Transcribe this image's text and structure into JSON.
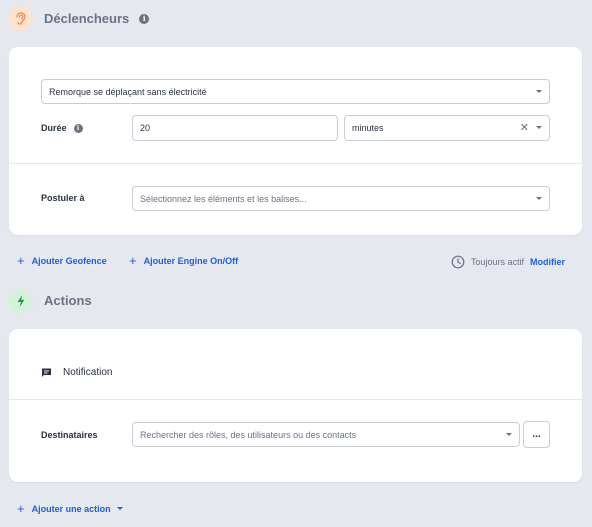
{
  "triggers": {
    "title": "Déclencheurs",
    "condition_value": "Remorque se déplaçant sans électricité",
    "duration_label": "Durée",
    "duration_value": "20",
    "unit_value": "minutes",
    "apply_label": "Postuler à",
    "apply_placeholder": "Sélectionnez les éléments et les balises..."
  },
  "links": {
    "add_geofence": "Ajouter Geofence",
    "add_engine": "Ajouter Engine On/Off",
    "always_active": "Toujours actif",
    "modify": "Modifier"
  },
  "actions": {
    "title": "Actions",
    "notification_label": "Notification",
    "recipients_label": "Destinataires",
    "recipients_placeholder": "Rechercher des rôles, des utilisateurs ou des contacts",
    "more_label": "...",
    "add_action": "Ajouter une action"
  },
  "colors": {
    "accent": "#1f5fd6",
    "trigger_icon_bg": "#fde2d0",
    "trigger_icon": "#ef8a4e",
    "action_icon_bg": "#d5f1dc",
    "action_icon": "#22a047"
  }
}
